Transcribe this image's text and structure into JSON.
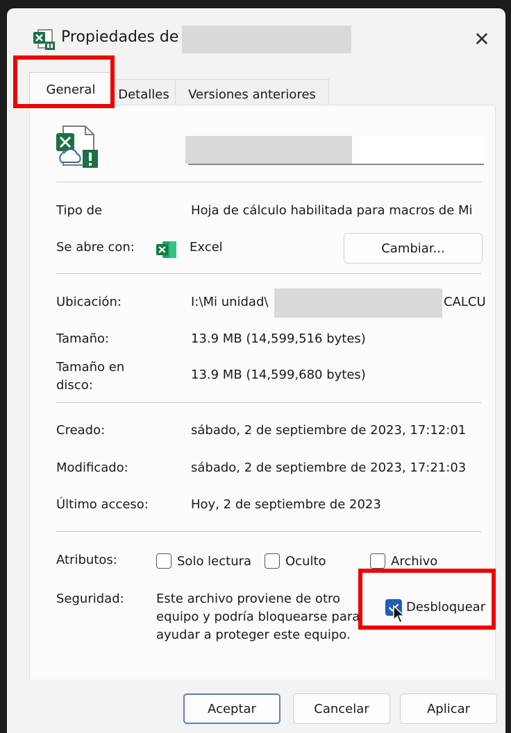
{
  "window": {
    "title": "Propiedades de",
    "close_glyph": "✕"
  },
  "tabs": [
    {
      "label": "General",
      "active": true
    },
    {
      "label": "Detalles",
      "active": false
    },
    {
      "label": "Versiones anteriores",
      "active": false
    }
  ],
  "general": {
    "file_type_label": "Tipo de",
    "file_type_value": "Hoja de cálculo habilitada para macros de Mi",
    "opens_with_label": "Se abre con:",
    "opens_with_app": "Excel",
    "change_button": "Cambiar...",
    "location_label": "Ubicación:",
    "location_prefix": "I:\\Mi unidad\\",
    "location_suffix": "CALCUI",
    "size_label": "Tamaño:",
    "size_value": "13.9 MB (14,599,516 bytes)",
    "size_on_disk_label_1": "Tamaño en",
    "size_on_disk_label_2": "disco:",
    "size_on_disk_value": "13.9 MB (14,599,680 bytes)",
    "created_label": "Creado:",
    "created_value": "sábado, 2 de septiembre de 2023, 17:12:01",
    "modified_label": "Modificado:",
    "modified_value": "sábado, 2 de septiembre de 2023, 17:21:03",
    "accessed_label": "Último acceso:",
    "accessed_value": "Hoy, 2 de septiembre de 2023",
    "attributes_label": "Atributos:",
    "attr_readonly": "Solo lectura",
    "attr_readonly_checked": false,
    "attr_hidden": "Oculto",
    "attr_hidden_checked": false,
    "attr_archive": "Archivo",
    "attr_archive_checked": false,
    "security_label": "Seguridad:",
    "security_text_1": "Este archivo proviene de otro",
    "security_text_2": "equipo y podría bloquearse para",
    "security_text_3": "ayudar a proteger este equipo.",
    "unblock_label": "Desbloquear",
    "unblock_checked": true
  },
  "footer": {
    "ok": "Aceptar",
    "cancel": "Cancelar",
    "apply": "Aplicar"
  },
  "colors": {
    "highlight": "#ee0000",
    "excel_green": "#1d7044",
    "checkbox_blue": "#1f5fb4"
  },
  "icons": {
    "title": "excel-file-icon",
    "file": "excel-cloud-warning-icon",
    "app": "excel-app-icon",
    "cursor": "mouse-pointer-icon"
  }
}
